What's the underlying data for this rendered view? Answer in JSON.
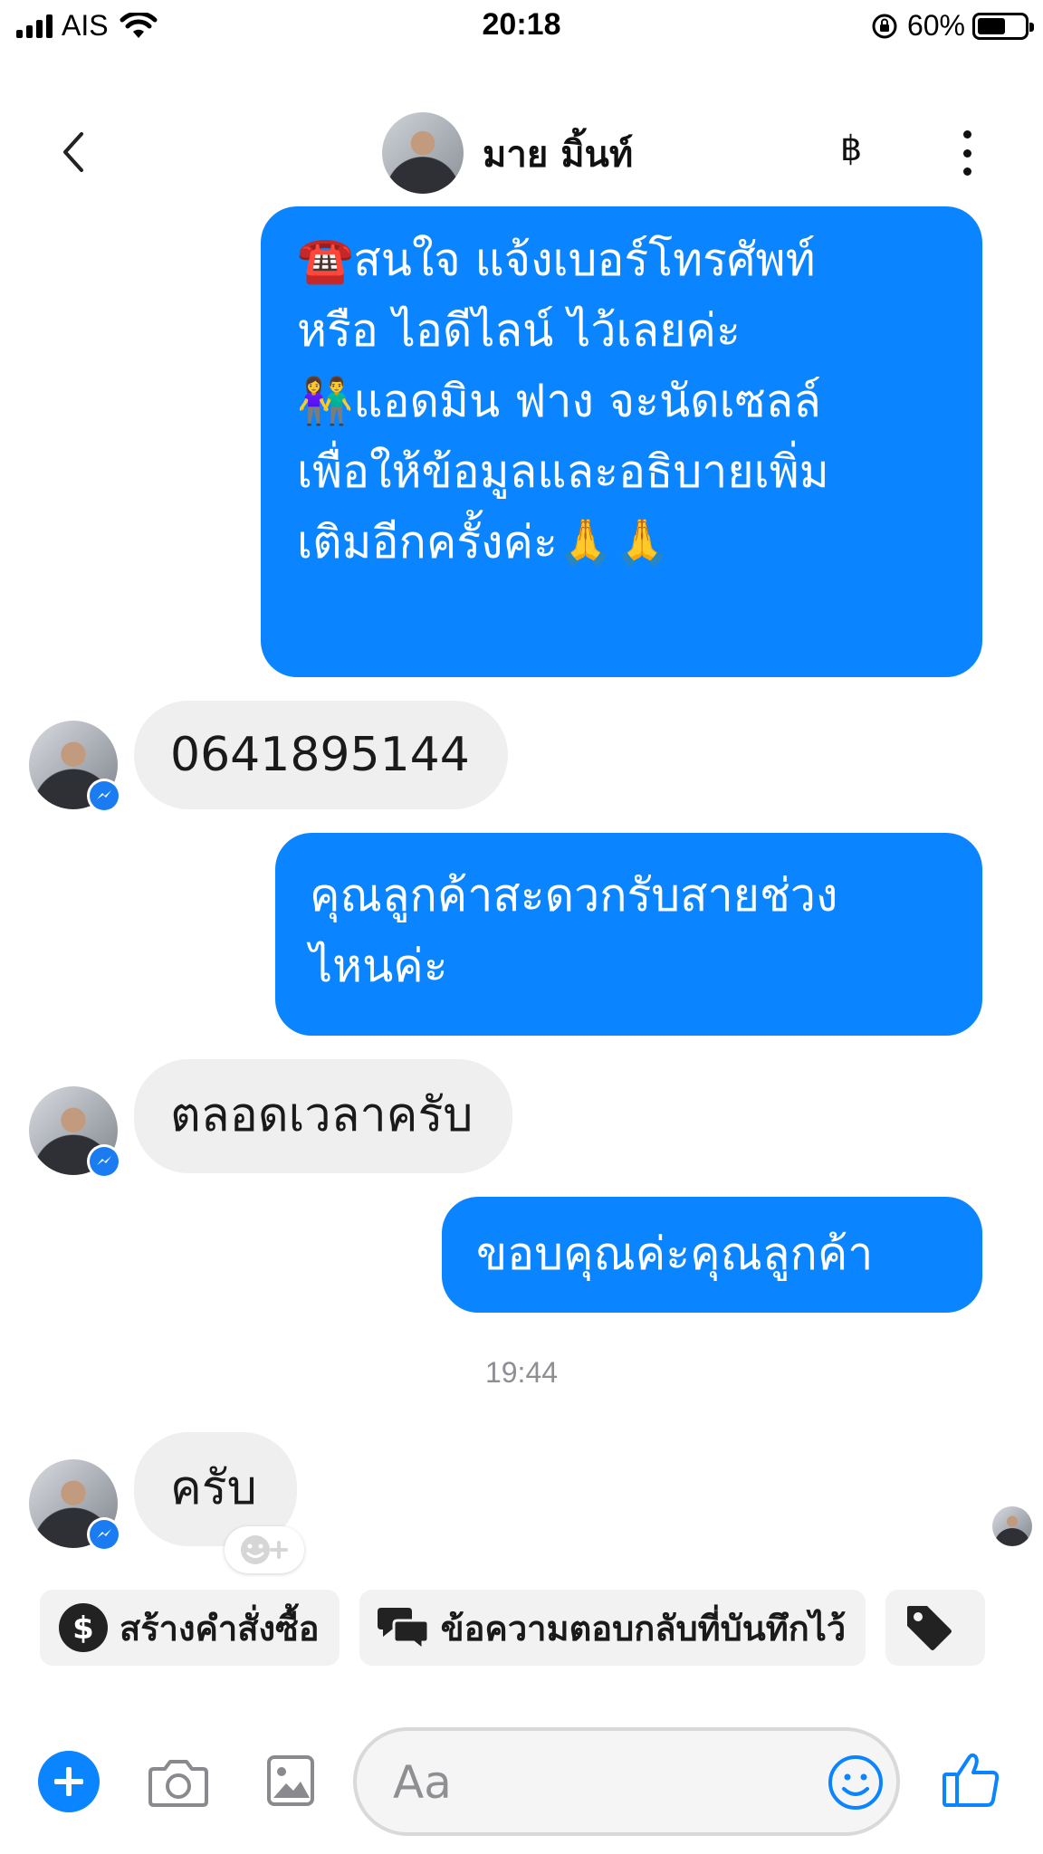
{
  "status_bar": {
    "carrier": "AIS",
    "time": "20:18",
    "battery_percent_label": "60%",
    "battery_level": 0.6
  },
  "header": {
    "contact_name": "มาย มิ้นท์",
    "currency_symbol": "฿",
    "icons": [
      "back-chevron-icon",
      "more-vertical-icon"
    ]
  },
  "messages": [
    {
      "direction": "outgoing",
      "lines": [
        "☎️สนใจ แจ้งเบอร์โทรศัพท์",
        "หรือ ไอดีไลน์  ไว้เลยค่ะ",
        "👫แอดมิน ฟาง จะนัดเซลล์",
        "เพื่อให้ข้อมูลและอธิบายเพิ่ม",
        "เติมอีกครั้งค่ะ🙏🙏"
      ]
    },
    {
      "direction": "incoming",
      "text": "0641895144"
    },
    {
      "direction": "outgoing",
      "lines": [
        "คุณลูกค้าสะดวกรับสายช่วง",
        "ไหนค่ะ"
      ]
    },
    {
      "direction": "incoming",
      "text": "ตลอดเวลาครับ"
    },
    {
      "direction": "outgoing",
      "lines": [
        "ขอบคุณค่ะคุณลูกค้า"
      ]
    },
    {
      "type": "timestamp",
      "text": "19:44"
    },
    {
      "direction": "incoming",
      "text": "ครับ"
    }
  ],
  "quick_replies": [
    {
      "label": "สร้างคำสั่งซื้อ",
      "icon": "dollar-circle-icon"
    },
    {
      "label": "ข้อความตอบกลับที่บันทึกไว้",
      "icon": "chat-bubbles-icon"
    },
    {
      "label": "",
      "icon": "tag-icon"
    }
  ],
  "composer": {
    "placeholder": "Aa",
    "icons": [
      "plus-icon",
      "camera-icon",
      "gallery-icon",
      "emoji-icon",
      "thumbs-up-icon"
    ]
  },
  "colors": {
    "accent_blue": "#0a84ff",
    "incoming_bubble": "#efefef"
  }
}
